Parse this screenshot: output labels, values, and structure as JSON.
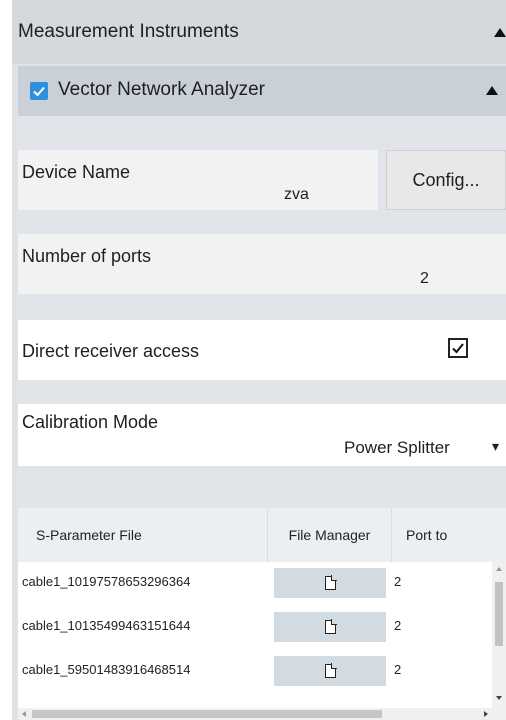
{
  "section": {
    "title": "Measurement Instruments"
  },
  "analyzer": {
    "label": "Vector Network Analyzer",
    "enabled": true
  },
  "device": {
    "label": "Device Name",
    "value": "zva",
    "config_label": "Config..."
  },
  "ports": {
    "label": "Number of ports",
    "value": "2"
  },
  "receiver": {
    "label": "Direct receiver access",
    "checked": true
  },
  "calibration": {
    "label": "Calibration Mode",
    "value": "Power Splitter",
    "arrow": "▾"
  },
  "table": {
    "headers": [
      "S-Parameter File",
      "File Manager",
      "Port to"
    ],
    "rows": [
      {
        "file": "cable1_10197578653296364",
        "port": "2"
      },
      {
        "file": "cable1_10135499463151644",
        "port": "2"
      },
      {
        "file": "cable1_59501483916468514",
        "port": "2"
      }
    ]
  },
  "checkmark": "✓"
}
